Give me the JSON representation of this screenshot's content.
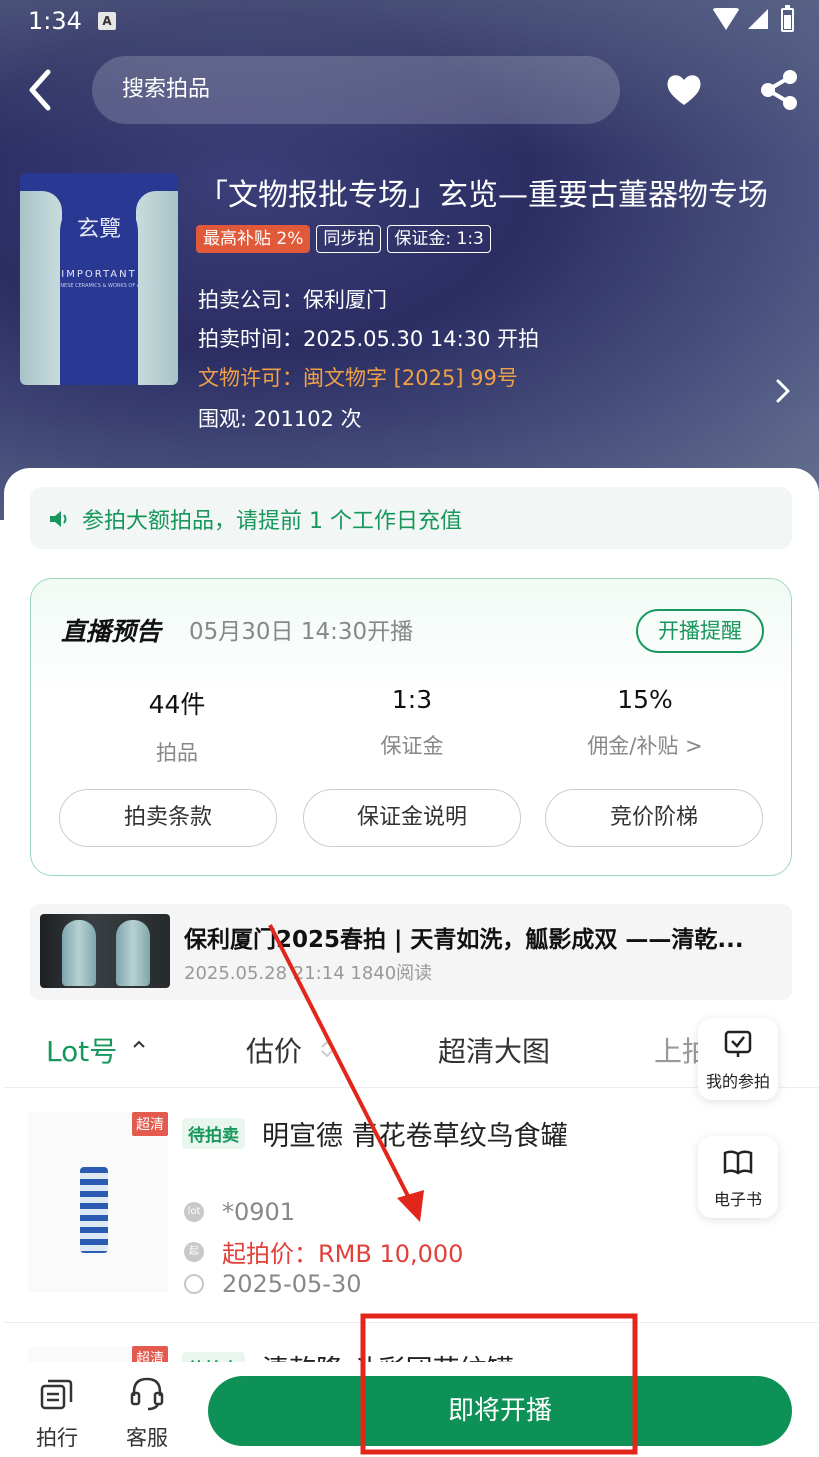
{
  "status_bar": {
    "time": "1:34",
    "indicator": "A"
  },
  "header": {
    "search_placeholder": "搜索拍品"
  },
  "auction": {
    "poster_title": "玄覽",
    "poster_subtitle": "IMPORTANT",
    "poster_line": "CHINESE CERAMICS & WORKS OF ART",
    "title": "「文物报批专场」玄览—重要古董器物专场",
    "tags": [
      "最高补贴 2%",
      "同步拍",
      "保证金: 1:3"
    ],
    "company": "拍卖公司：保利厦门",
    "time": "拍卖时间：2025.05.30 14:30 开拍",
    "license": "文物许可：闽文物字 [2025] 99号",
    "views": "围观: 201102 次"
  },
  "notice": {
    "text": "参拍大额拍品，请提前 1 个工作日充值"
  },
  "live": {
    "title": "直播预告",
    "time": "05月30日 14:30开播",
    "remind_label": "开播提醒",
    "stats": [
      {
        "value": "44件",
        "label": "拍品"
      },
      {
        "value": "1:3",
        "label": "保证金"
      },
      {
        "value": "15%",
        "label": "佣金/补贴 >"
      }
    ],
    "buttons": [
      "拍卖条款",
      "保证金说明",
      "竞价阶梯"
    ]
  },
  "article": {
    "title": "保利厦门2025春拍 | 天青如洗，觚影成双 ——清乾...",
    "meta": "2025.05.28 21:14   1840阅读"
  },
  "sort_bar": {
    "items": [
      "Lot号",
      "估价",
      "超清大图",
      "上拍"
    ]
  },
  "floating": {
    "my_bids": "我的参拍",
    "ebook": "电子书"
  },
  "lots": [
    {
      "badge": "超清",
      "status": "待拍卖",
      "name": "明宣德 青花卷草纹鸟食罐",
      "lot_icon": "lot",
      "lot_no": "*0901",
      "start_icon": "起",
      "start_price": "起拍价：RMB 10,000",
      "date": "2025-05-30"
    },
    {
      "badge": "超清",
      "status": "待拍卖",
      "name": "清乾隆 斗彩团花纹罐"
    }
  ],
  "bottom_bar": {
    "item1": "拍行",
    "item2": "客服",
    "live_button": "即将开播"
  },
  "colors": {
    "accent": "#17975c",
    "button": "#0e9157",
    "price": "#e0413a",
    "annotation": "#e3261c"
  }
}
